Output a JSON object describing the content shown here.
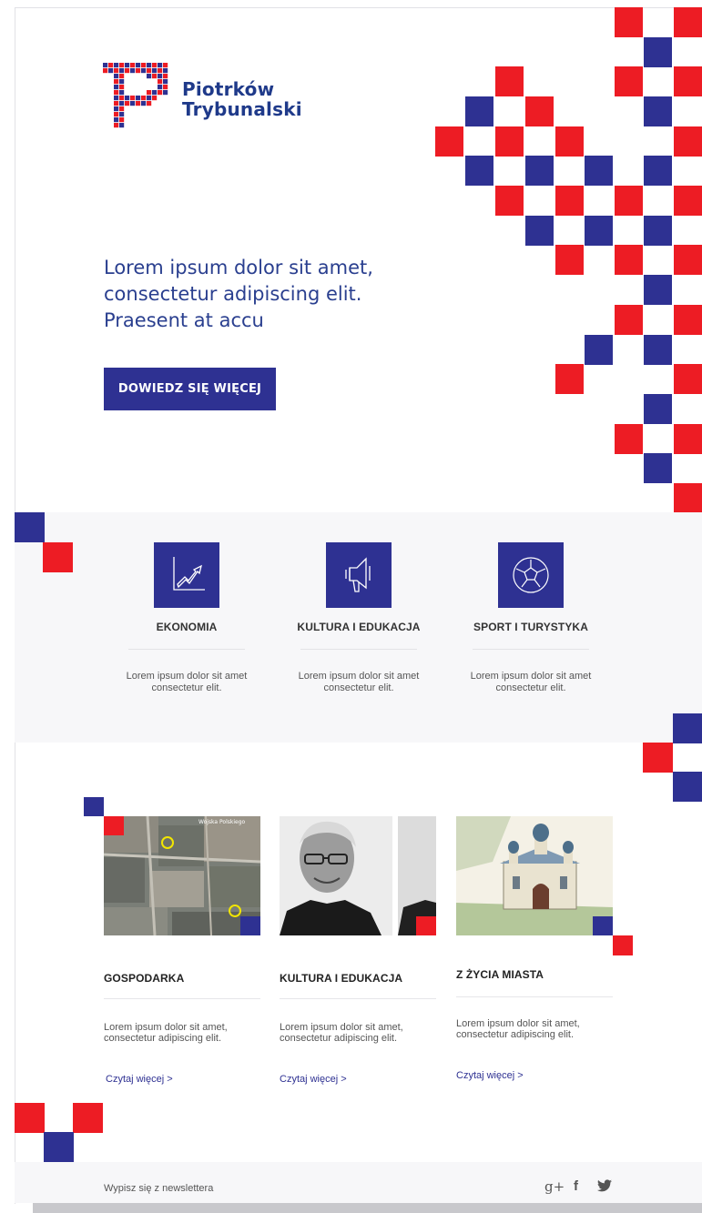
{
  "brand": {
    "line1": "Piotrków",
    "line2": "Trybunalski",
    "colors": {
      "blue": "#2e3192",
      "red": "#ed1c24",
      "text_blue": "#2a3f8f"
    }
  },
  "hero": {
    "headline": "Lorem ipsum dolor sit amet, consectetur adipiscing elit. Praesent at accu",
    "cta_label": "DOWIEDZ SIĘ WIĘCEJ"
  },
  "categories": [
    {
      "title": "EKONOMIA",
      "desc": "Lorem ipsum dolor sit amet consectetur elit.",
      "icon": "chart-growth-icon"
    },
    {
      "title": "KULTURA I EDUKACJA",
      "desc": "Lorem ipsum dolor sit amet consectetur elit.",
      "icon": "megaphone-icon"
    },
    {
      "title": "SPORT I TURYSTYKA",
      "desc": "Lorem ipsum dolor sit amet consectetur elit.",
      "icon": "football-icon"
    }
  ],
  "articles": [
    {
      "title": "GOSPODARKA",
      "desc": "Lorem ipsum dolor sit amet, consectetur adipiscing elit.",
      "link": "Czytaj więcej  >"
    },
    {
      "title": "KULTURA I EDUKACJA",
      "desc": "Lorem ipsum dolor sit amet, consectetur adipiscing elit.",
      "link": "Czytaj więcej >"
    },
    {
      "title": "Z ŻYCIA MIASTA",
      "desc": "Lorem ipsum dolor sit amet, consectetur adipiscing elit.",
      "link": "Czytaj więcej >"
    }
  ],
  "map_label": "Wojska Polskiego",
  "footer": {
    "newsletter": "Wypisz się z newslettera",
    "social": {
      "gplus": "g+",
      "facebook": "f"
    }
  }
}
